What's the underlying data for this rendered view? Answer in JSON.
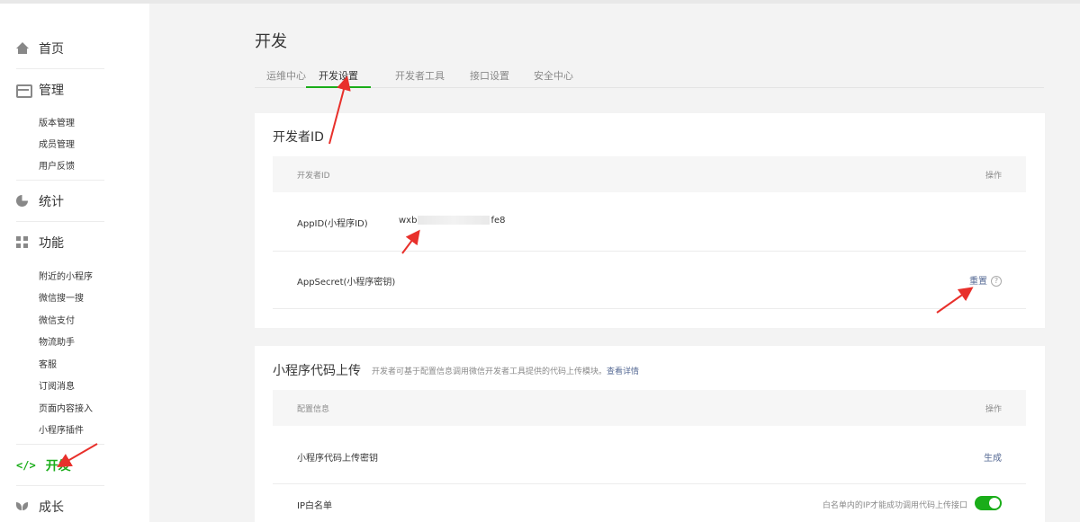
{
  "sidebar": {
    "groups": [
      {
        "label": "首页",
        "icon": "home-icon"
      },
      {
        "label": "管理",
        "icon": "manage-icon",
        "items": [
          "版本管理",
          "成员管理",
          "用户反馈"
        ]
      },
      {
        "label": "统计",
        "icon": "stats-icon"
      },
      {
        "label": "功能",
        "icon": "feature-icon",
        "items": [
          "附近的小程序",
          "微信搜一搜",
          "微信支付",
          "物流助手",
          "客服",
          "订阅消息",
          "页面内容接入",
          "小程序插件"
        ]
      },
      {
        "label": "开发",
        "icon": "code-icon",
        "active": true,
        "glyph": "</>"
      },
      {
        "label": "成长",
        "icon": "growth-icon"
      }
    ]
  },
  "page": {
    "title": "开发"
  },
  "tabs": [
    {
      "label": "运维中心"
    },
    {
      "label": "开发设置",
      "active": true
    },
    {
      "label": "开发者工具"
    },
    {
      "label": "接口设置"
    },
    {
      "label": "安全中心"
    }
  ],
  "developer_id": {
    "title": "开发者ID",
    "header": {
      "col1": "开发者ID",
      "col2": "操作"
    },
    "rows": [
      {
        "label": "AppID(小程序ID)",
        "value_prefix": "wxb",
        "value_suffix": "fe8"
      },
      {
        "label": "AppSecret(小程序密钥)",
        "action": "重置",
        "help": "?"
      }
    ]
  },
  "code_upload": {
    "title": "小程序代码上传",
    "desc": "开发者可基于配置信息调用微信开发者工具提供的代码上传模块。",
    "desc_link": "查看详情",
    "header": {
      "col1": "配置信息",
      "col2": "操作"
    },
    "rows": [
      {
        "label": "小程序代码上传密钥",
        "action": "生成"
      },
      {
        "label": "IP白名单",
        "note": "白名单内的IP才能成功调用代码上传接口",
        "toggle_on": true
      }
    ]
  },
  "colors": {
    "accent": "#1aad19",
    "link": "#576b95",
    "arrow": "#e8302b"
  }
}
